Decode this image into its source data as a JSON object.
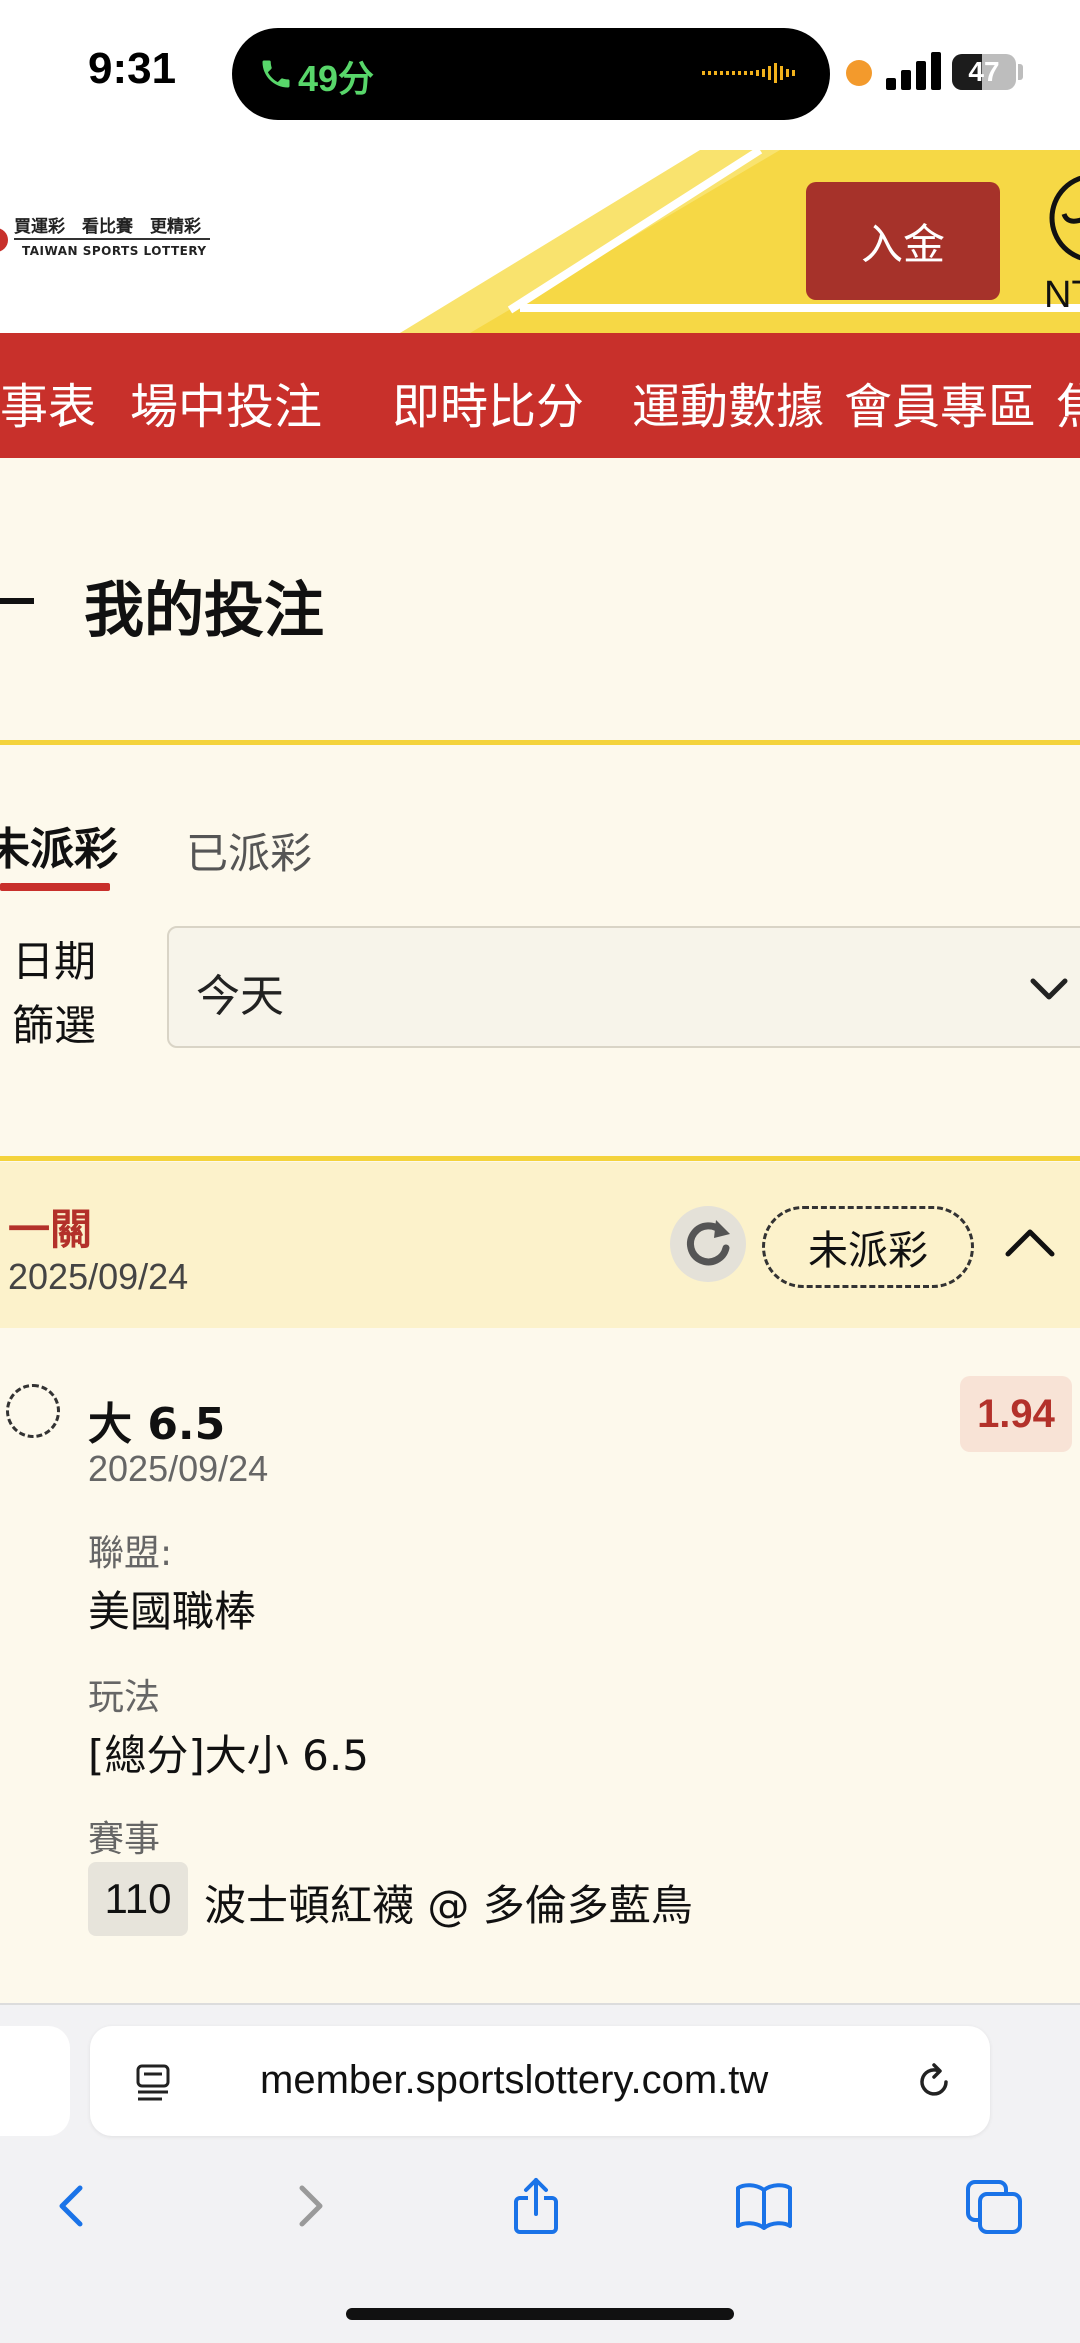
{
  "status_bar": {
    "time": "9:31",
    "call_duration": "49分",
    "battery_level": "47",
    "colors": {
      "call": "#58d66a",
      "recording_dot": "#f39a2c"
    }
  },
  "header": {
    "logo_line1": "買運彩　看比賽　更精彩",
    "logo_line2": "TAIWAN SPORTS LOTTERY",
    "deposit_label": "入金",
    "currency_partial": "NT"
  },
  "nav": {
    "items": [
      "賽事表",
      "場中投注",
      "即時比分",
      "運動數據",
      "會員專區",
      "焦點"
    ]
  },
  "page": {
    "title": "我的投注",
    "tabs": [
      {
        "label": "未派彩",
        "active": true
      },
      {
        "label": "已派彩",
        "active": false
      }
    ],
    "date_filter": {
      "label": "日期篩選",
      "value": "今天"
    }
  },
  "bet": {
    "type": "一關",
    "date": "2025/09/24",
    "status": "未派彩",
    "selection": "大 6.5",
    "selection_date": "2025/09/24",
    "odds": "1.94",
    "league_label": "聯盟:",
    "league": "美國職棒",
    "market_label": "玩法",
    "market": "[總分]大小 6.5",
    "event_label": "賽事",
    "event_no": "110",
    "event_name": "波士頓紅襪 @ 多倫多藍鳥"
  },
  "browser": {
    "url": "member.sportslottery.com.tw"
  },
  "theme": {
    "brand_red": "#c8302b",
    "deposit_red": "#a6322a",
    "accent_yellow": "#f4d33c",
    "page_bg": "#fdf9ec",
    "card_header_bg": "#fcf2cb"
  },
  "icons": [
    "call-icon",
    "waveform-icon",
    "signal-icon",
    "battery-icon",
    "refresh-icon",
    "chevron-down-icon",
    "chevron-up-icon",
    "pending-icon",
    "reader-icon",
    "reload-icon",
    "back-icon",
    "forward-icon",
    "share-icon",
    "bookmarks-icon",
    "tabs-icon"
  ]
}
